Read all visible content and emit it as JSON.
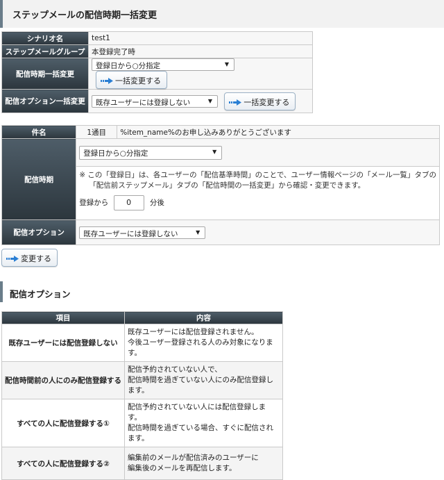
{
  "page_title": "ステップメールの配信時期一括変更",
  "settings": {
    "scenario_label": "シナリオ名",
    "scenario_value": "test1",
    "group_label": "ステップメールグループ",
    "group_value": "本登録完了時",
    "timing_label": "配信時期一括変更",
    "timing_select": "登録日から○分指定",
    "timing_button": "一括変更する",
    "option_label": "配信オプション一括変更",
    "option_select": "既存ユーザーには登録しない",
    "option_button": "一括変更する"
  },
  "detail": {
    "subject_label": "件名",
    "step_label": "1通目",
    "subject_value": "%item_name%のお申し込みありがとうございます",
    "timing_label": "配信時期",
    "timing_select": "登録日から○分指定",
    "note_line1": "※ この「登録日」は、各ユーザーの「配信基準時間」のことで、ユーザー情報ページの「メール一覧」タブの",
    "note_line2": "「配信前ステップメール」タブの「配信時間の一括変更」から確認・変更できます。",
    "from_label": "登録から",
    "minutes_value": "0",
    "after_label": "分後",
    "option_label": "配信オプション",
    "option_select": "既存ユーザーには登録しない"
  },
  "change_button": "変更する",
  "options_section": {
    "title": "配信オプション",
    "col_item": "項目",
    "col_content": "内容",
    "rows": [
      {
        "item": "既存ユーザーには配信登録しない",
        "line1": "既存ユーザーには配信登録されません。",
        "line2": "今後ユーザー登録される人のみ対象になります。"
      },
      {
        "item": "配信時間前の人にのみ配信登録する",
        "line1": "配信予約されていない人で、",
        "line2": "配信時間を過ぎていない人にのみ配信登録します。"
      },
      {
        "item": "すべての人に配信登録する①",
        "line1": "配信予約されていない人には配信登録します。",
        "line2": "配信時間を過ぎている場合、すぐに配信されます。"
      },
      {
        "item": "すべての人に配信登録する②",
        "line1": "編集前のメールが配信済みのユーザーに",
        "line2": "編集後のメールを再配信します。"
      }
    ]
  },
  "colors": {
    "header_dark": "#2c363d",
    "accent_blue": "#2a7fd4",
    "border": "#c9c9c9"
  }
}
